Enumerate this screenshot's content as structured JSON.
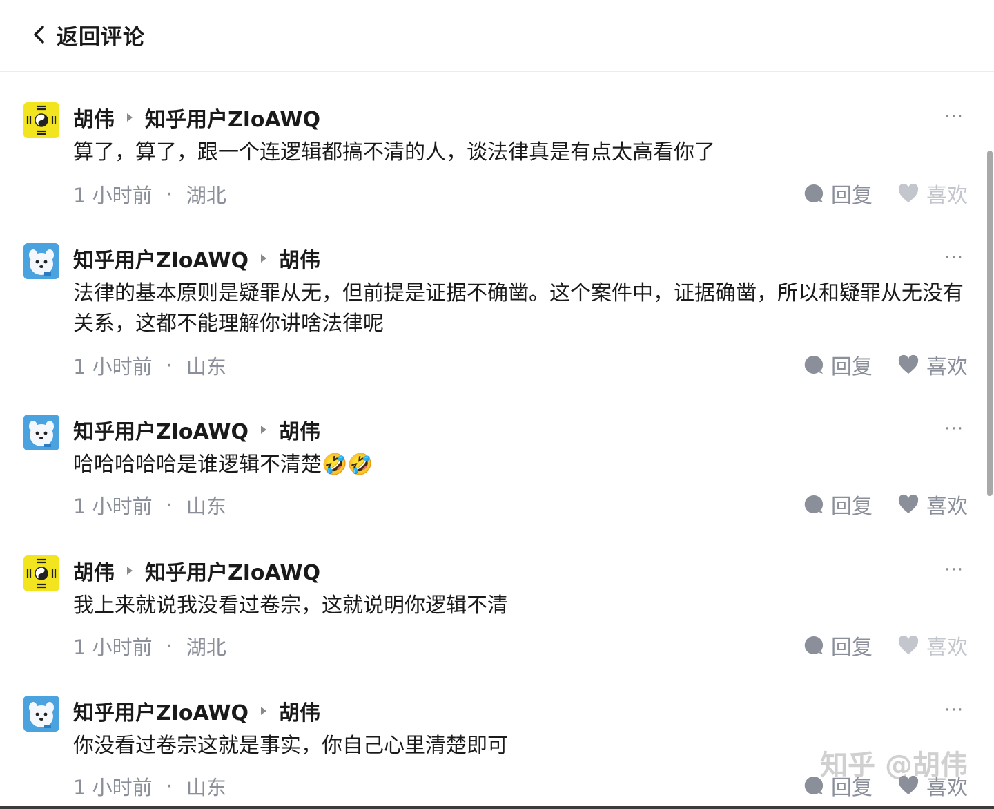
{
  "header": {
    "back_label": "返回评论"
  },
  "comments": [
    {
      "author": "胡伟",
      "reply_to": "知乎用户ZIoAWQ",
      "avatar": "bagua-avatar",
      "text": "算了，算了，跟一个连逻辑都搞不清的人，谈法律真是有点太高看你了",
      "time": "1 小时前",
      "sep": "·",
      "location": "湖北",
      "reply_label": "回复",
      "like_label": "喜欢",
      "liked": false,
      "more": "···"
    },
    {
      "author": "知乎用户ZIoAWQ",
      "reply_to": "胡伟",
      "avatar": "cartoon-dog-avatar",
      "text": "法律的基本原则是疑罪从无，但前提是证据不确凿。这个案件中，证据确凿，所以和疑罪从无没有关系，这都不能理解你讲啥法律呢",
      "time": "1 小时前",
      "sep": "·",
      "location": "山东",
      "reply_label": "回复",
      "like_label": "喜欢",
      "liked": true,
      "more": "···"
    },
    {
      "author": "知乎用户ZIoAWQ",
      "reply_to": "胡伟",
      "avatar": "cartoon-dog-avatar",
      "text": "哈哈哈哈哈是谁逻辑不清楚🤣🤣",
      "time": "1 小时前",
      "sep": "·",
      "location": "山东",
      "reply_label": "回复",
      "like_label": "喜欢",
      "liked": true,
      "more": "···"
    },
    {
      "author": "胡伟",
      "reply_to": "知乎用户ZIoAWQ",
      "avatar": "bagua-avatar",
      "text": "我上来就说我没看过卷宗，这就说明你逻辑不清",
      "time": "1 小时前",
      "sep": "·",
      "location": "湖北",
      "reply_label": "回复",
      "like_label": "喜欢",
      "liked": false,
      "more": "···"
    },
    {
      "author": "知乎用户ZIoAWQ",
      "reply_to": "胡伟",
      "avatar": "cartoon-dog-avatar",
      "text": "你没看过卷宗这就是事实，你自己心里清楚即可",
      "time": "1 小时前",
      "sep": "·",
      "location": "山东",
      "reply_label": "回复",
      "like_label": "喜欢",
      "liked": true,
      "more": "···"
    }
  ],
  "watermark": "知乎 @胡伟",
  "colors": {
    "meta": "#8a8f99",
    "bubble": "#8a8f99",
    "like_on": "#8a8f99",
    "like_off": "#c3c6cc"
  }
}
